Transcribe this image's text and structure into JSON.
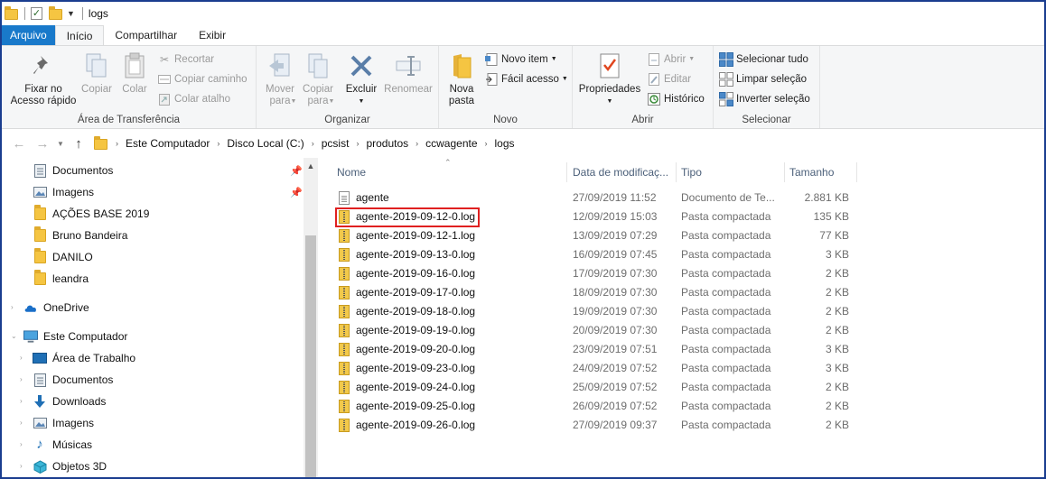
{
  "window": {
    "title": "logs"
  },
  "tabs": [
    {
      "label": "Arquivo"
    },
    {
      "label": "Início"
    },
    {
      "label": "Compartilhar"
    },
    {
      "label": "Exibir"
    }
  ],
  "ribbon": {
    "clipboard": {
      "label": "Área de Transferência",
      "pin_label": "Fixar no Acesso rápido",
      "copy_label": "Copiar",
      "paste_label": "Colar",
      "cut_label": "Recortar",
      "copy_path_label": "Copiar caminho",
      "paste_shortcut_label": "Colar atalho"
    },
    "organize": {
      "label": "Organizar",
      "move_to_label": "Mover para",
      "copy_to_label": "Copiar para",
      "delete_label": "Excluir",
      "rename_label": "Renomear"
    },
    "new": {
      "label": "Novo",
      "new_folder_label": "Nova pasta",
      "new_item_label": "Novo item",
      "easy_access_label": "Fácil acesso"
    },
    "open": {
      "label": "Abrir",
      "properties_label": "Propriedades",
      "open_label": "Abrir",
      "edit_label": "Editar",
      "history_label": "Histórico"
    },
    "select": {
      "label": "Selecionar",
      "select_all_label": "Selecionar tudo",
      "select_none_label": "Limpar seleção",
      "invert_label": "Inverter seleção"
    }
  },
  "address": {
    "crumbs": [
      "Este Computador",
      "Disco Local (C:)",
      "pcsist",
      "produtos",
      "ccwagente",
      "logs"
    ]
  },
  "nav": {
    "quick_access": [
      {
        "label": "Documentos",
        "icon": "documents-icon",
        "pinned": true
      },
      {
        "label": "Imagens",
        "icon": "pictures-icon",
        "pinned": true
      },
      {
        "label": "AÇÕES BASE 2019",
        "icon": "folder-icon",
        "pinned": false
      },
      {
        "label": "Bruno Bandeira",
        "icon": "folder-icon",
        "pinned": false
      },
      {
        "label": "DANILO",
        "icon": "folder-icon",
        "pinned": false
      },
      {
        "label": "leandra",
        "icon": "folder-icon",
        "pinned": false
      }
    ],
    "onedrive": "OneDrive",
    "this_pc": "Este Computador",
    "this_pc_items": [
      {
        "label": "Área de Trabalho",
        "icon": "desktop-icon"
      },
      {
        "label": "Documentos",
        "icon": "documents-icon"
      },
      {
        "label": "Downloads",
        "icon": "downloads-icon"
      },
      {
        "label": "Imagens",
        "icon": "pictures-icon"
      },
      {
        "label": "Músicas",
        "icon": "music-icon"
      },
      {
        "label": "Objetos 3D",
        "icon": "objects-3d-icon"
      }
    ]
  },
  "files": {
    "columns": [
      "Nome",
      "Data de modificaç...",
      "Tipo",
      "Tamanho"
    ],
    "rows": [
      {
        "name": "agente",
        "date": "27/09/2019 11:52",
        "type": "Documento de Te...",
        "size": "2.881 KB",
        "icon": "text-file"
      },
      {
        "name": "agente-2019-09-12-0.log",
        "date": "12/09/2019 15:03",
        "type": "Pasta compactada",
        "size": "135 KB",
        "icon": "zip"
      },
      {
        "name": "agente-2019-09-12-1.log",
        "date": "13/09/2019 07:29",
        "type": "Pasta compactada",
        "size": "77 KB",
        "icon": "zip"
      },
      {
        "name": "agente-2019-09-13-0.log",
        "date": "16/09/2019 07:45",
        "type": "Pasta compactada",
        "size": "3 KB",
        "icon": "zip"
      },
      {
        "name": "agente-2019-09-16-0.log",
        "date": "17/09/2019 07:30",
        "type": "Pasta compactada",
        "size": "2 KB",
        "icon": "zip"
      },
      {
        "name": "agente-2019-09-17-0.log",
        "date": "18/09/2019 07:30",
        "type": "Pasta compactada",
        "size": "2 KB",
        "icon": "zip"
      },
      {
        "name": "agente-2019-09-18-0.log",
        "date": "19/09/2019 07:30",
        "type": "Pasta compactada",
        "size": "2 KB",
        "icon": "zip"
      },
      {
        "name": "agente-2019-09-19-0.log",
        "date": "20/09/2019 07:30",
        "type": "Pasta compactada",
        "size": "2 KB",
        "icon": "zip"
      },
      {
        "name": "agente-2019-09-20-0.log",
        "date": "23/09/2019 07:51",
        "type": "Pasta compactada",
        "size": "3 KB",
        "icon": "zip"
      },
      {
        "name": "agente-2019-09-23-0.log",
        "date": "24/09/2019 07:52",
        "type": "Pasta compactada",
        "size": "3 KB",
        "icon": "zip"
      },
      {
        "name": "agente-2019-09-24-0.log",
        "date": "25/09/2019 07:52",
        "type": "Pasta compactada",
        "size": "2 KB",
        "icon": "zip"
      },
      {
        "name": "agente-2019-09-25-0.log",
        "date": "26/09/2019 07:52",
        "type": "Pasta compactada",
        "size": "2 KB",
        "icon": "zip"
      },
      {
        "name": "agente-2019-09-26-0.log",
        "date": "27/09/2019 09:37",
        "type": "Pasta compactada",
        "size": "2 KB",
        "icon": "zip"
      }
    ]
  },
  "colors": {
    "accent": "#1979ca",
    "highlight": "#e02020",
    "frame": "#1a3d8f"
  }
}
